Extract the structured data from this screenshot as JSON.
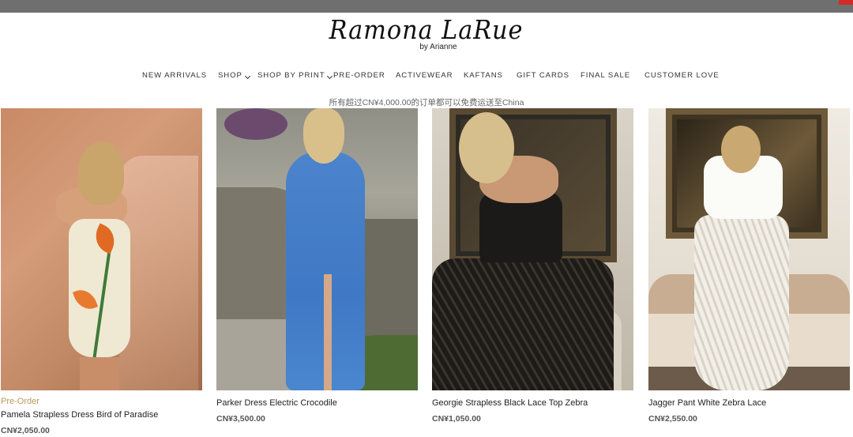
{
  "brand": {
    "logo_text": "Ramona LaRue",
    "byline": "by Arianne"
  },
  "nav": {
    "items": [
      {
        "label": "NEW ARRIVALS",
        "has_dropdown": false
      },
      {
        "label": "SHOP",
        "has_dropdown": true
      },
      {
        "label": "SHOP BY PRINT",
        "has_dropdown": true
      },
      {
        "label": "PRE-ORDER",
        "has_dropdown": false
      },
      {
        "label": "ACTIVEWEAR",
        "has_dropdown": false
      },
      {
        "label": "KAFTANS",
        "has_dropdown": false
      },
      {
        "label": "GIFT CARDS",
        "has_dropdown": false
      },
      {
        "label": "FINAL SALE",
        "has_dropdown": false
      },
      {
        "label": "CUSTOMER LOVE",
        "has_dropdown": false
      }
    ]
  },
  "announcement": "所有超过CN¥4,000.00的订单都可以免费运送至China",
  "products": [
    {
      "badge": "Pre-Order",
      "name": "Pamela Strapless Dress Bird of Paradise",
      "price": "CN¥2,050.00"
    },
    {
      "badge": "",
      "name": "Parker Dress Electric Crocodile",
      "price": "CN¥3,500.00"
    },
    {
      "badge": "",
      "name": "Georgie Strapless Black Lace Top Zebra",
      "price": "CN¥1,050.00"
    },
    {
      "badge": "",
      "name": "Jagger Pant White Zebra Lace",
      "price": "CN¥2,550.00"
    }
  ],
  "colors": {
    "topbar": "#6f6f6f",
    "badge": "#b99a5a",
    "accent_corner": "#d42a2a"
  }
}
